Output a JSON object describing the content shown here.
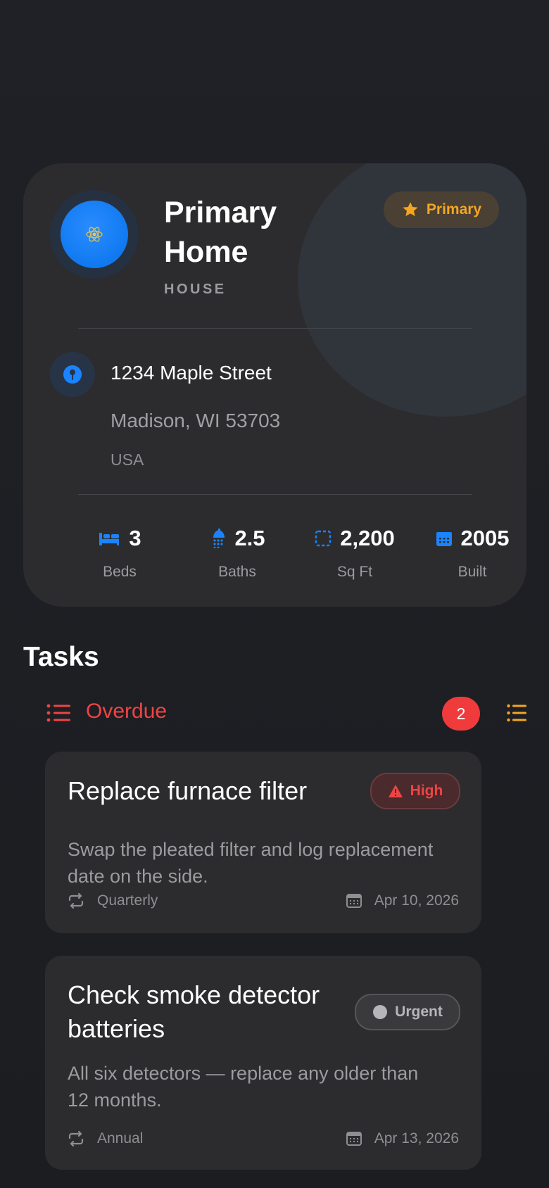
{
  "property": {
    "name": "Primary Home",
    "type": "HOUSE",
    "badge": "Primary",
    "address": {
      "street": "1234 Maple Street",
      "city_line": "Madison, WI 53703",
      "country": "USA"
    },
    "stats": [
      {
        "value": "3",
        "label": "Beds",
        "icon": "bed-icon"
      },
      {
        "value": "2.5",
        "label": "Baths",
        "icon": "shower-icon"
      },
      {
        "value": "2,200",
        "label": "Sq Ft",
        "icon": "area-icon"
      },
      {
        "value": "2005",
        "label": "Built",
        "icon": "calendar-icon"
      }
    ]
  },
  "tasks": {
    "title": "Tasks",
    "section": {
      "label": "Overdue",
      "count": "2"
    },
    "items": [
      {
        "title": "Replace furnace filter",
        "description": "Swap the pleated filter and log replacement date on the side.",
        "priority": "High",
        "recurrence": "Quarterly",
        "due": "Apr 10, 2026"
      },
      {
        "title": "Check smoke detector batteries",
        "description": "All six detectors — replace any older than 12 months.",
        "priority": "Urgent",
        "recurrence": "Annual",
        "due": "Apr 13, 2026"
      }
    ]
  },
  "colors": {
    "accent_blue": "#1a84ff",
    "primary_gold": "#f4a622",
    "overdue_red": "#ef4444"
  }
}
